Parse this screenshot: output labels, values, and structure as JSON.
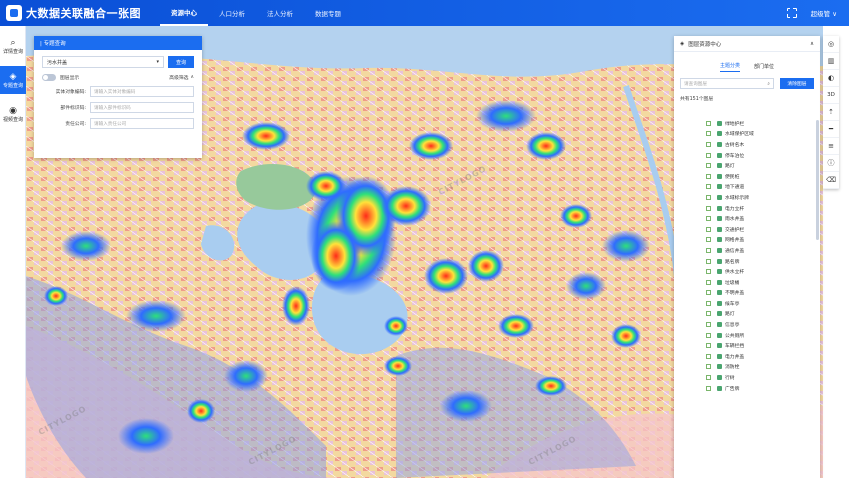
{
  "header": {
    "title": "大数据关联融合一张图",
    "tabs": [
      {
        "label": "资源中心",
        "active": true
      },
      {
        "label": "人口分析",
        "active": false
      },
      {
        "label": "法人分析",
        "active": false
      },
      {
        "label": "数据专题",
        "active": false
      }
    ],
    "user": "超级管 ∨"
  },
  "rail": [
    {
      "label": "详情查询",
      "icon": "search-icon",
      "active": false
    },
    {
      "label": "专题查询",
      "icon": "layers-search-icon",
      "active": true
    },
    {
      "label": "视频查询",
      "icon": "camera-icon",
      "active": false
    }
  ],
  "query_panel": {
    "title": "| 专题查询",
    "category_value": "污水井盖",
    "search_label": "查询",
    "toggle_label": "图层显示",
    "collapse_label": "高级筛选",
    "fields": [
      {
        "label": "实体对象编码:",
        "placeholder": "请输入实体对象编码"
      },
      {
        "label": "部件标识码:",
        "placeholder": "请输入部件标识码"
      },
      {
        "label": "责任公司:",
        "placeholder": "请输入责任公司"
      }
    ]
  },
  "right_panel": {
    "title": "图层资源中心",
    "tabs": [
      {
        "label": "主题分类",
        "active": true
      },
      {
        "label": "部门单位",
        "active": false
      }
    ],
    "search_placeholder": "请查询图层",
    "clear_label": "清除图层",
    "count_text": "共有151个图层",
    "layers": [
      "绿地护栏",
      "水域保护区域",
      "古树名木",
      "停车泊位",
      "路灯",
      "便民桩",
      "地下通道",
      "水域标示牌",
      "电力立杆",
      "雨水井盖",
      "交通护栏",
      "网格井盖",
      "通信井盖",
      "路名牌",
      "供水立杆",
      "垃圾桶",
      "不明井盖",
      "候车亭",
      "路灯",
      "信息亭",
      "公共厕所",
      "车辆拦挡",
      "电力井盖",
      "消防栓",
      "行树",
      "广告牌"
    ]
  },
  "tools": [
    {
      "icon": "globe-icon",
      "glyph": "◎"
    },
    {
      "icon": "map-icon",
      "glyph": "▥"
    },
    {
      "icon": "earth-icon",
      "glyph": "◐"
    },
    {
      "icon": "3d-icon",
      "glyph": "3D"
    },
    {
      "icon": "compass-icon",
      "glyph": "⇡"
    },
    {
      "icon": "measure-icon",
      "glyph": "━"
    },
    {
      "icon": "layers-icon",
      "glyph": "≡"
    },
    {
      "icon": "info-icon",
      "glyph": "ⓘ"
    },
    {
      "icon": "trash-icon",
      "glyph": "⌫"
    }
  ],
  "colors": {
    "primary": "#1b6df0",
    "header": "#0a4fd6",
    "heat_core": "#ff2a1a"
  }
}
